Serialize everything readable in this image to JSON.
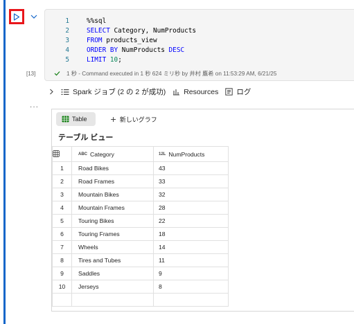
{
  "cell": {
    "execution_count": "[13]",
    "code": [
      {
        "n": "1",
        "tokens": [
          {
            "t": "%%sql",
            "c": "plain"
          }
        ]
      },
      {
        "n": "2",
        "tokens": [
          {
            "t": "SELECT",
            "c": "kw"
          },
          {
            "t": " Category, NumProducts",
            "c": "plain"
          }
        ]
      },
      {
        "n": "3",
        "tokens": [
          {
            "t": "FROM",
            "c": "kw"
          },
          {
            "t": " products_view",
            "c": "plain"
          }
        ]
      },
      {
        "n": "4",
        "tokens": [
          {
            "t": "ORDER BY",
            "c": "kw"
          },
          {
            "t": " NumProducts ",
            "c": "plain"
          },
          {
            "t": "DESC",
            "c": "kw"
          }
        ]
      },
      {
        "n": "5",
        "tokens": [
          {
            "t": "LIMIT",
            "c": "kw"
          },
          {
            "t": " ",
            "c": "plain"
          },
          {
            "t": "10",
            "c": "num"
          },
          {
            "t": ";",
            "c": "plain"
          }
        ]
      }
    ],
    "status": "1 秒 - Command executed in 1 秒 624 ミリ秒 by 井村 鷹希 on 11:53:29 AM, 6/21/25"
  },
  "jobs": {
    "spark_label": "Spark ジョブ (2 の 2 が成功)",
    "resources_label": "Resources",
    "log_label": "ログ"
  },
  "result": {
    "tab_table_label": "Table",
    "new_graph_label": "新しいグラフ",
    "view_title": "テーブル ビュー",
    "columns": [
      {
        "type": "ABC",
        "name": "Category"
      },
      {
        "type": "12L",
        "name": "NumProducts"
      }
    ],
    "rows": [
      {
        "idx": "1",
        "category": "Road Bikes",
        "num": "43"
      },
      {
        "idx": "2",
        "category": "Road Frames",
        "num": "33"
      },
      {
        "idx": "3",
        "category": "Mountain Bikes",
        "num": "32"
      },
      {
        "idx": "4",
        "category": "Mountain Frames",
        "num": "28"
      },
      {
        "idx": "5",
        "category": "Touring Bikes",
        "num": "22"
      },
      {
        "idx": "6",
        "category": "Touring Frames",
        "num": "18"
      },
      {
        "idx": "7",
        "category": "Wheels",
        "num": "14"
      },
      {
        "idx": "8",
        "category": "Tires and Tubes",
        "num": "11"
      },
      {
        "idx": "9",
        "category": "Saddles",
        "num": "9"
      },
      {
        "idx": "10",
        "category": "Jerseys",
        "num": "8"
      }
    ]
  },
  "colors": {
    "accent": "#1466c9",
    "run_highlight": "#e8161b",
    "success": "#107c10"
  }
}
